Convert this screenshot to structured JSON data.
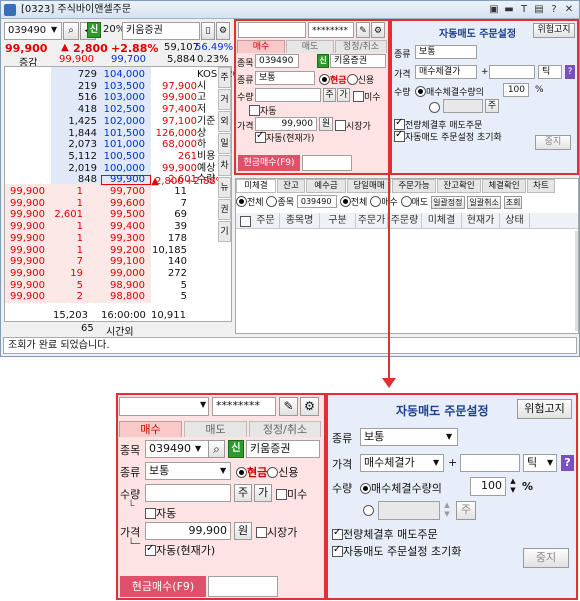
{
  "window": {
    "title": "[0323] 주식바이앤셀주문"
  },
  "order": {
    "code": "039490",
    "pct": "20%",
    "stock_name": "키움증권",
    "sin": "신",
    "price": "99,900",
    "change": "2,800",
    "rate": "+2.88%",
    "volume": "59,107",
    "vol_rate": "56.49%",
    "label_change": "증감",
    "bid_top": "99,900",
    "ask_top": "99,700",
    "qty1": "5,884",
    "r2": "0.23%"
  },
  "asks": [
    {
      "qty": "729",
      "price": "104,000"
    },
    {
      "qty": "219",
      "price": "103,500"
    },
    {
      "qty": "516",
      "price": "103,000"
    },
    {
      "qty": "418",
      "price": "102,500"
    },
    {
      "qty": "1,425",
      "price": "102,000"
    },
    {
      "qty": "1,844",
      "price": "101,500"
    },
    {
      "qty": "2,073",
      "price": "101,000"
    },
    {
      "qty": "5,112",
      "price": "100,500"
    },
    {
      "qty": "2,019",
      "price": "100,000"
    },
    {
      "qty": "848",
      "price": "99,900"
    }
  ],
  "info": [
    {
      "label": "KOSPI200",
      "val": ""
    },
    {
      "label": "시",
      "val": "97,900"
    },
    {
      "label": "고",
      "val": "99,900"
    },
    {
      "label": "저",
      "val": "97,400"
    },
    {
      "label": "기준",
      "val": "97,100"
    },
    {
      "label": "상",
      "val": "126,000"
    },
    {
      "label": "하",
      "val": "68,000"
    },
    {
      "label": "비용",
      "val": "261"
    },
    {
      "label": "예상",
      "val": "99,900"
    },
    {
      "label": "수량",
      "val": "2,601"
    }
  ],
  "expected": {
    "change": "2,800",
    "rate": "+2.88%"
  },
  "side_tabs": [
    "주",
    "거",
    "외",
    "일",
    "차",
    "뉴",
    "권",
    "기"
  ],
  "bids": [
    {
      "price": "99,700",
      "qty": "11",
      "q2": "1"
    },
    {
      "price": "99,600",
      "qty": "7",
      "q2": "1"
    },
    {
      "price": "99,500",
      "qty": "69",
      "q2": "2,601"
    },
    {
      "price": "99,400",
      "qty": "39",
      "q2": "1"
    },
    {
      "price": "99,300",
      "qty": "178",
      "q2": "1"
    },
    {
      "price": "99,200",
      "qty": "10,185",
      "q2": "1"
    },
    {
      "price": "99,100",
      "qty": "140",
      "q2": "7"
    },
    {
      "price": "99,000",
      "qty": "272",
      "q2": "19"
    },
    {
      "price": "98,900",
      "qty": "5",
      "q2": "5"
    },
    {
      "price": "98,800",
      "qty": "5",
      "q2": "2"
    }
  ],
  "bid_left_prices": [
    "99,900",
    "99,900",
    "99,900",
    "99,900",
    "99,900",
    "99,900",
    "99,900",
    "99,900",
    "99,900",
    "99,900"
  ],
  "totals": {
    "ask_total": "15,203",
    "time": "16:00:00",
    "bid_total": "10,911",
    "count": "65",
    "time_label": "시간외"
  },
  "status": "조회가 완료 되었습니다.",
  "account": {
    "password": "********"
  },
  "tabs": {
    "buy": "매수",
    "sell": "매도",
    "modify": "정정/취소"
  },
  "form": {
    "code_label": "종목",
    "code": "039490",
    "stock": "키움증권",
    "sin": "신",
    "type_label": "종류",
    "type": "보통",
    "cash": "현금",
    "credit": "신용",
    "qty_label": "수량",
    "qty_btn": "주",
    "price_btn": "가",
    "mi": "미수",
    "auto": "자동",
    "price_label": "가격",
    "price": "99,900",
    "won": "원",
    "market": "시장가",
    "auto_now": "자동(현재가)",
    "submit": "현금매수(F9)"
  },
  "auto_sell": {
    "title": "자동매도 주문설정",
    "risk": "위험고지",
    "type_label": "종류",
    "type": "보통",
    "price_label": "가격",
    "price_type": "매수체결가",
    "plus": "+",
    "tick": "틱",
    "help": "?",
    "qty_label": "수량",
    "qty_option": "매수체결수량의",
    "qty_pct": "100",
    "pct_mark": "%",
    "ju": "주",
    "opt1": "전량체결후 매도주문",
    "opt2": "자동매도 주문설정 초기화",
    "stop": "중지"
  },
  "list_tabs": [
    "미체결",
    "잔고",
    "예수금",
    "당일매매",
    "주문가능",
    "잔고확인",
    "체결확인",
    "차트"
  ],
  "filter": {
    "all": "전체",
    "stock": "종목",
    "code": "039490",
    "all2": "전체",
    "buy": "매수",
    "sell": "매도",
    "b1": "일괄정정",
    "b2": "일괄취소",
    "b3": "조회"
  },
  "columns": [
    "주문",
    "종목명",
    "구분",
    "주문가",
    "주문량",
    "미체결",
    "현재가",
    "상태"
  ]
}
